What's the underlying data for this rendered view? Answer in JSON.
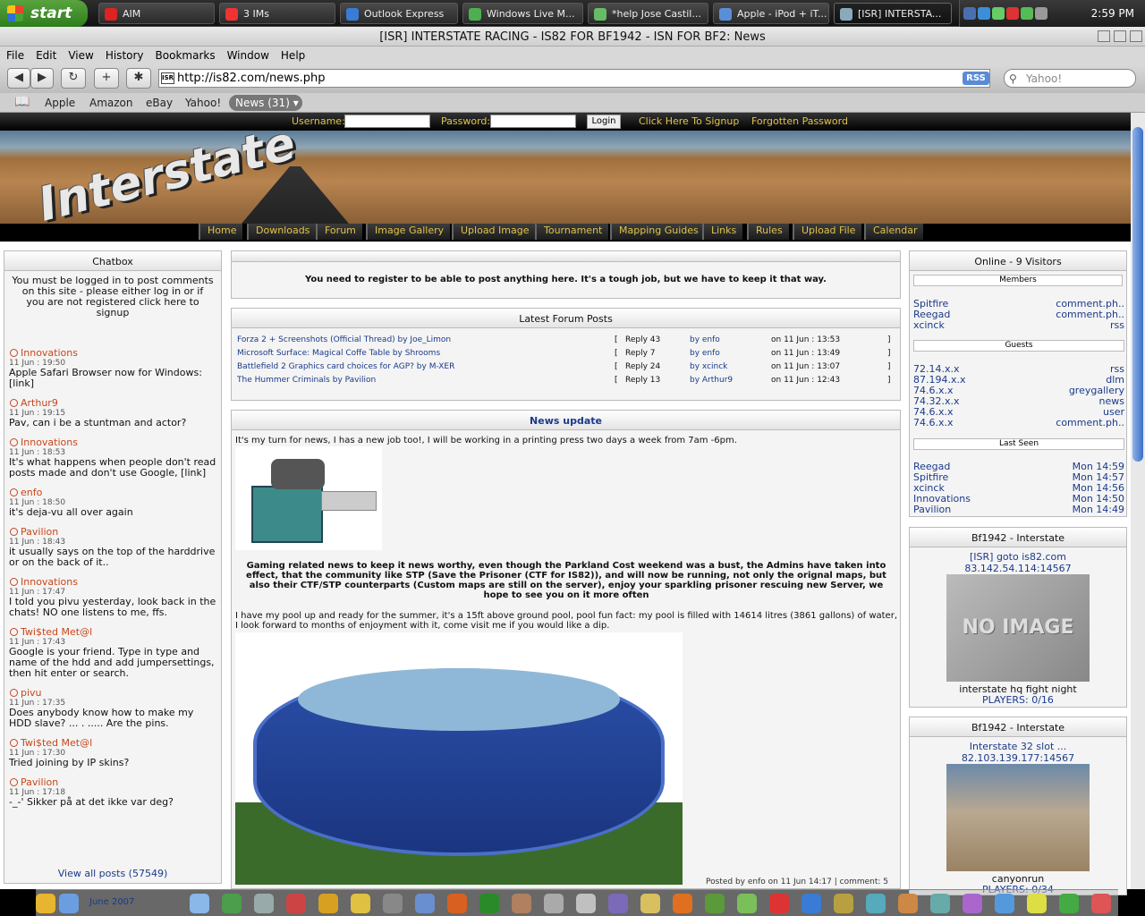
{
  "taskbar": {
    "start": "start",
    "buttons": [
      "AIM",
      "3 IMs",
      "Outlook Express",
      "Windows Live M...",
      "*help Jose Castil...",
      "Apple - iPod + iT...",
      "[ISR] INTERSTA..."
    ],
    "clock": "2:59 PM"
  },
  "window": {
    "title": "[ISR] INTERSTATE RACING - IS82 FOR BF1942 - ISN FOR BF2: News"
  },
  "menu": [
    "File",
    "Edit",
    "View",
    "History",
    "Bookmarks",
    "Window",
    "Help"
  ],
  "toolbar": {
    "url": "http://is82.com/news.php",
    "favicon": "ISR",
    "rss": "RSS",
    "search_placeholder": "Yahoo!"
  },
  "bookmarks": {
    "items": [
      "Apple",
      "Amazon",
      "eBay",
      "Yahoo!"
    ],
    "news": "News (31) ▾"
  },
  "login": {
    "username": "Username:",
    "password": "Password:",
    "login": "Login",
    "signup": "Click Here To Signup",
    "forgot": "Forgotten Password"
  },
  "site": {
    "logo": "Interstate"
  },
  "nav": [
    "Home",
    "Downloads",
    "Forum",
    "Image Gallery",
    "Upload Image",
    "Tournament",
    "Mapping Guides",
    "Links",
    "Rules",
    "Upload File",
    "Calendar"
  ],
  "chatbox": {
    "title": "Chatbox",
    "notice": "You must be logged in to post comments on this site - please either log in or if you are not registered click here to signup",
    "posts": [
      {
        "name": "Innovations",
        "time": "11 Jun : 19:50",
        "text": "Apple Safari Browser now for Windows: [link]"
      },
      {
        "name": "Arthur9",
        "time": "11 Jun : 19:15",
        "text": "Pav, can i be a stuntman and actor?"
      },
      {
        "name": "Innovations",
        "time": "11 Jun : 18:53",
        "text": "It's what happens when people don't read posts made and don't use Google, [link]"
      },
      {
        "name": "enfo",
        "time": "11 Jun : 18:50",
        "text": "it's deja-vu all over again"
      },
      {
        "name": "Pavilion",
        "time": "11 Jun : 18:43",
        "text": "it usually says on the top of the harddrive or on the back of it.."
      },
      {
        "name": "Innovations",
        "time": "11 Jun : 17:47",
        "text": "I told you pivu yesterday, look back in the chats! NO one listens to me, ffs."
      },
      {
        "name": "Twi$ted Met@l",
        "time": "11 Jun : 17:43",
        "text": "Google is your friend. Type in type and name of the hdd and add jumpersettings, then hit enter or search."
      },
      {
        "name": "pivu",
        "time": "11 Jun : 17:35",
        "text": "Does anybody know how to make my HDD slave? ... . ..... Are the pins."
      },
      {
        "name": "Twi$ted Met@l",
        "time": "11 Jun : 17:30",
        "text": "Tried joining by IP skins?"
      },
      {
        "name": "Pavilion",
        "time": "11 Jun : 17:18",
        "text": "-_-' Sikker på at det ikke var deg?"
      }
    ],
    "view_all": "View all posts (57549)"
  },
  "notice": "You need to register to be able to post anything here. It's a tough job, but we have to keep it that way.",
  "forum": {
    "title": "Latest Forum Posts",
    "rows": [
      {
        "thread": "Forza 2 + Screenshots (Official Thread)",
        "by": "Joe_Limon",
        "reply": "Reply 43",
        "user": "enfo",
        "date": "11 Jun : 13:53"
      },
      {
        "thread": "Microsoft Surface: Magical Coffe Table",
        "by": "Shrooms",
        "reply": "Reply 7",
        "user": "enfo",
        "date": "11 Jun : 13:49"
      },
      {
        "thread": "Battlefield 2 Graphics card choices for AGP?",
        "by": "M-XER",
        "reply": "Reply 24",
        "user": "xcinck",
        "date": "11 Jun : 13:07"
      },
      {
        "thread": "The Hummer Criminals",
        "by": "Pavilion",
        "reply": "Reply 13",
        "user": "Arthur9",
        "date": "11 Jun : 12:43"
      }
    ]
  },
  "news": {
    "title": "News update",
    "p1": "It's my turn for news, I has a new job too!, I will be working in a printing press two days a week from 7am -6pm.",
    "p2": "Gaming related news to keep it news worthy, even though the Parkland Cost weekend was a bust, the Admins have taken into effect, that the community like STP (Save the Prisoner (CTF for IS82)), and will now be running, not only the orignal maps, but also their CTF/STP counterparts (Custom maps are still on the server), enjoy your sparkling prisoner rescuing new Server, we hope to see you on it more often",
    "p3": "I have my pool up and ready for the summer, it's a 15ft above ground pool, pool fun fact: my pool is filled with 14614 litres (3861 gallons) of water, I look forward to months of enjoyment with it, come visit me if you would like a dip.",
    "footer": "Posted by enfo on 11 Jun 14:17 | comment: 5"
  },
  "online": {
    "title": "Online - 9 Visitors",
    "members_h": "Members",
    "members": [
      [
        "Spitfire",
        "comment.ph.."
      ],
      [
        "Reegad",
        "comment.ph.."
      ],
      [
        "xcinck",
        "rss"
      ]
    ],
    "guests_h": "Guests",
    "guests": [
      [
        "72.14.x.x",
        "rss"
      ],
      [
        "87.194.x.x",
        "dlm"
      ],
      [
        "74.6.x.x",
        "greygallery"
      ],
      [
        "74.32.x.x",
        "news"
      ],
      [
        "74.6.x.x",
        "user"
      ],
      [
        "74.6.x.x",
        "comment.ph.."
      ]
    ],
    "last_h": "Last Seen",
    "last": [
      [
        "Reegad",
        "Mon 14:59"
      ],
      [
        "Spitfire",
        "Mon 14:57"
      ],
      [
        "xcinck",
        "Mon 14:56"
      ],
      [
        "Innovations",
        "Mon 14:50"
      ],
      [
        "Pavilion",
        "Mon 14:49"
      ]
    ]
  },
  "server1": {
    "title": "Bf1942 - Interstate",
    "name": "[ISR] goto is82.com",
    "ip": "83.142.54.114:14567",
    "noimg": "NO IMAGE",
    "map": "interstate hq fight night",
    "players": "PLAYERS: 0/16"
  },
  "server2": {
    "title": "Bf1942 - Interstate",
    "name": "Interstate 32 slot ...",
    "ip": "82.103.139.177:14567",
    "map": "canyonrun",
    "players": "PLAYERS: 0/34"
  },
  "dock": {
    "date": "June 2007"
  }
}
